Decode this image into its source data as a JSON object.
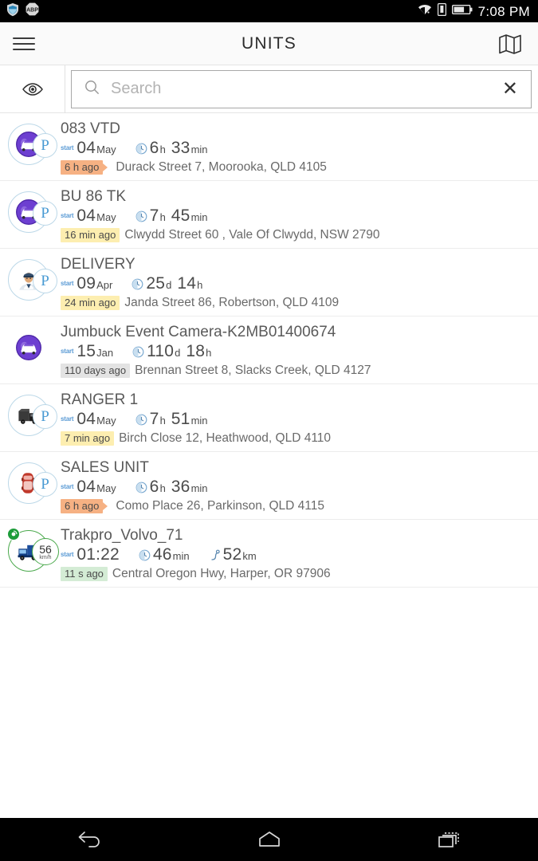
{
  "statusbar": {
    "time": "7:08 PM",
    "left_icons": [
      {
        "name": "shield-icon",
        "label": ""
      },
      {
        "name": "adblock-plus-icon",
        "label": "ABP"
      }
    ],
    "right_icons": [
      {
        "name": "wifi-icon"
      },
      {
        "name": "sim-card-icon"
      },
      {
        "name": "battery-icon"
      }
    ]
  },
  "appbar": {
    "menu_label": "menu",
    "title": "UNITS",
    "map_label": "map"
  },
  "search": {
    "eye_label": "visibility",
    "value": "",
    "placeholder": "Search",
    "clear_label": "✕"
  },
  "units": [
    {
      "name": "083 VTD",
      "avatar": {
        "vehicle": "car-front-purple",
        "ring": "blue",
        "badge": "P",
        "gps": false
      },
      "metrics": [
        {
          "icon": "start-label",
          "label": "start",
          "value": "04",
          "unit": "May"
        },
        {
          "icon": "clock-icon",
          "value": "6",
          "unit": "h",
          "value2": "33",
          "unit2": "min"
        }
      ],
      "ago": "6 h ago",
      "ago_color": "orange",
      "arrow": true,
      "address": "Durack Street 7, Moorooka, QLD 4105"
    },
    {
      "name": "BU 86 TK",
      "avatar": {
        "vehicle": "car-front-purple",
        "ring": "blue",
        "badge": "P",
        "gps": false
      },
      "metrics": [
        {
          "icon": "start-label",
          "label": "start",
          "value": "04",
          "unit": "May"
        },
        {
          "icon": "clock-icon",
          "value": "7",
          "unit": "h",
          "value2": "45",
          "unit2": "min"
        }
      ],
      "ago": "16 min ago",
      "ago_color": "yellow",
      "arrow": false,
      "address": "Clwydd Street 60 , Vale Of Clwydd, NSW 2790"
    },
    {
      "name": "DELIVERY",
      "avatar": {
        "vehicle": "driver-avatar",
        "ring": "blue",
        "badge": "P",
        "gps": false
      },
      "metrics": [
        {
          "icon": "start-label",
          "label": "start",
          "value": "09",
          "unit": "Apr"
        },
        {
          "icon": "clock-icon",
          "value": "25",
          "unit": "d",
          "value2": "14",
          "unit2": "h"
        }
      ],
      "ago": "24 min ago",
      "ago_color": "yellow",
      "arrow": false,
      "address": "Janda Street 86, Robertson, QLD 4109"
    },
    {
      "name": "Jumbuck Event Camera-K2MB01400674",
      "avatar": {
        "vehicle": "car-front-purple-solid",
        "ring": "none",
        "badge": "",
        "gps": false
      },
      "metrics": [
        {
          "icon": "start-label",
          "label": "start",
          "value": "15",
          "unit": "Jan"
        },
        {
          "icon": "clock-icon",
          "value": "110",
          "unit": "d",
          "value2": "18",
          "unit2": "h"
        }
      ],
      "ago": "110 days ago",
      "ago_color": "grey",
      "arrow": false,
      "address": "Brennan Street 8, Slacks Creek, QLD 4127"
    },
    {
      "name": "RANGER 1",
      "avatar": {
        "vehicle": "truck-dark",
        "ring": "blue",
        "badge": "P",
        "gps": false
      },
      "metrics": [
        {
          "icon": "start-label",
          "label": "start",
          "value": "04",
          "unit": "May"
        },
        {
          "icon": "clock-icon",
          "value": "7",
          "unit": "h",
          "value2": "51",
          "unit2": "min"
        }
      ],
      "ago": "7 min ago",
      "ago_color": "yellow",
      "arrow": false,
      "address": "Birch Close 12, Heathwood, QLD 4110"
    },
    {
      "name": "SALES UNIT",
      "avatar": {
        "vehicle": "car-top-red",
        "ring": "blue",
        "badge": "P",
        "gps": false
      },
      "metrics": [
        {
          "icon": "start-label",
          "label": "start",
          "value": "04",
          "unit": "May"
        },
        {
          "icon": "clock-icon",
          "value": "6",
          "unit": "h",
          "value2": "36",
          "unit2": "min"
        }
      ],
      "ago": "6 h ago",
      "ago_color": "orange",
      "arrow": true,
      "address": "Como Place 26, Parkinson, QLD 4115"
    },
    {
      "name": "Trakpro_Volvo_71",
      "avatar": {
        "vehicle": "truck-blue",
        "ring": "green",
        "badge": "",
        "gps": true,
        "speed": "56",
        "speed_unit": "km/h"
      },
      "metrics": [
        {
          "icon": "start-label",
          "label": "start",
          "value": "01:22",
          "unit": ""
        },
        {
          "icon": "clock-icon",
          "value": "46",
          "unit": "min",
          "value2": "",
          "unit2": ""
        },
        {
          "icon": "route-icon",
          "value": "52",
          "unit": "km",
          "value2": "",
          "unit2": ""
        }
      ],
      "ago": "11 s ago",
      "ago_color": "green",
      "arrow": false,
      "address": "Central Oregon Hwy, Harper, OR 97906"
    }
  ],
  "navbar": {
    "back_label": "back",
    "home_label": "home",
    "recents_label": "recent apps"
  },
  "colors": {
    "accent_blue": "#4a9bd4",
    "vehicle_purple": "#6d3fd1",
    "moving_green": "#49a84b",
    "badge_orange": "#f6b183",
    "badge_yellow": "#fdeeb0",
    "badge_grey": "#e3e3e3",
    "badge_green": "#d4ecd5"
  }
}
